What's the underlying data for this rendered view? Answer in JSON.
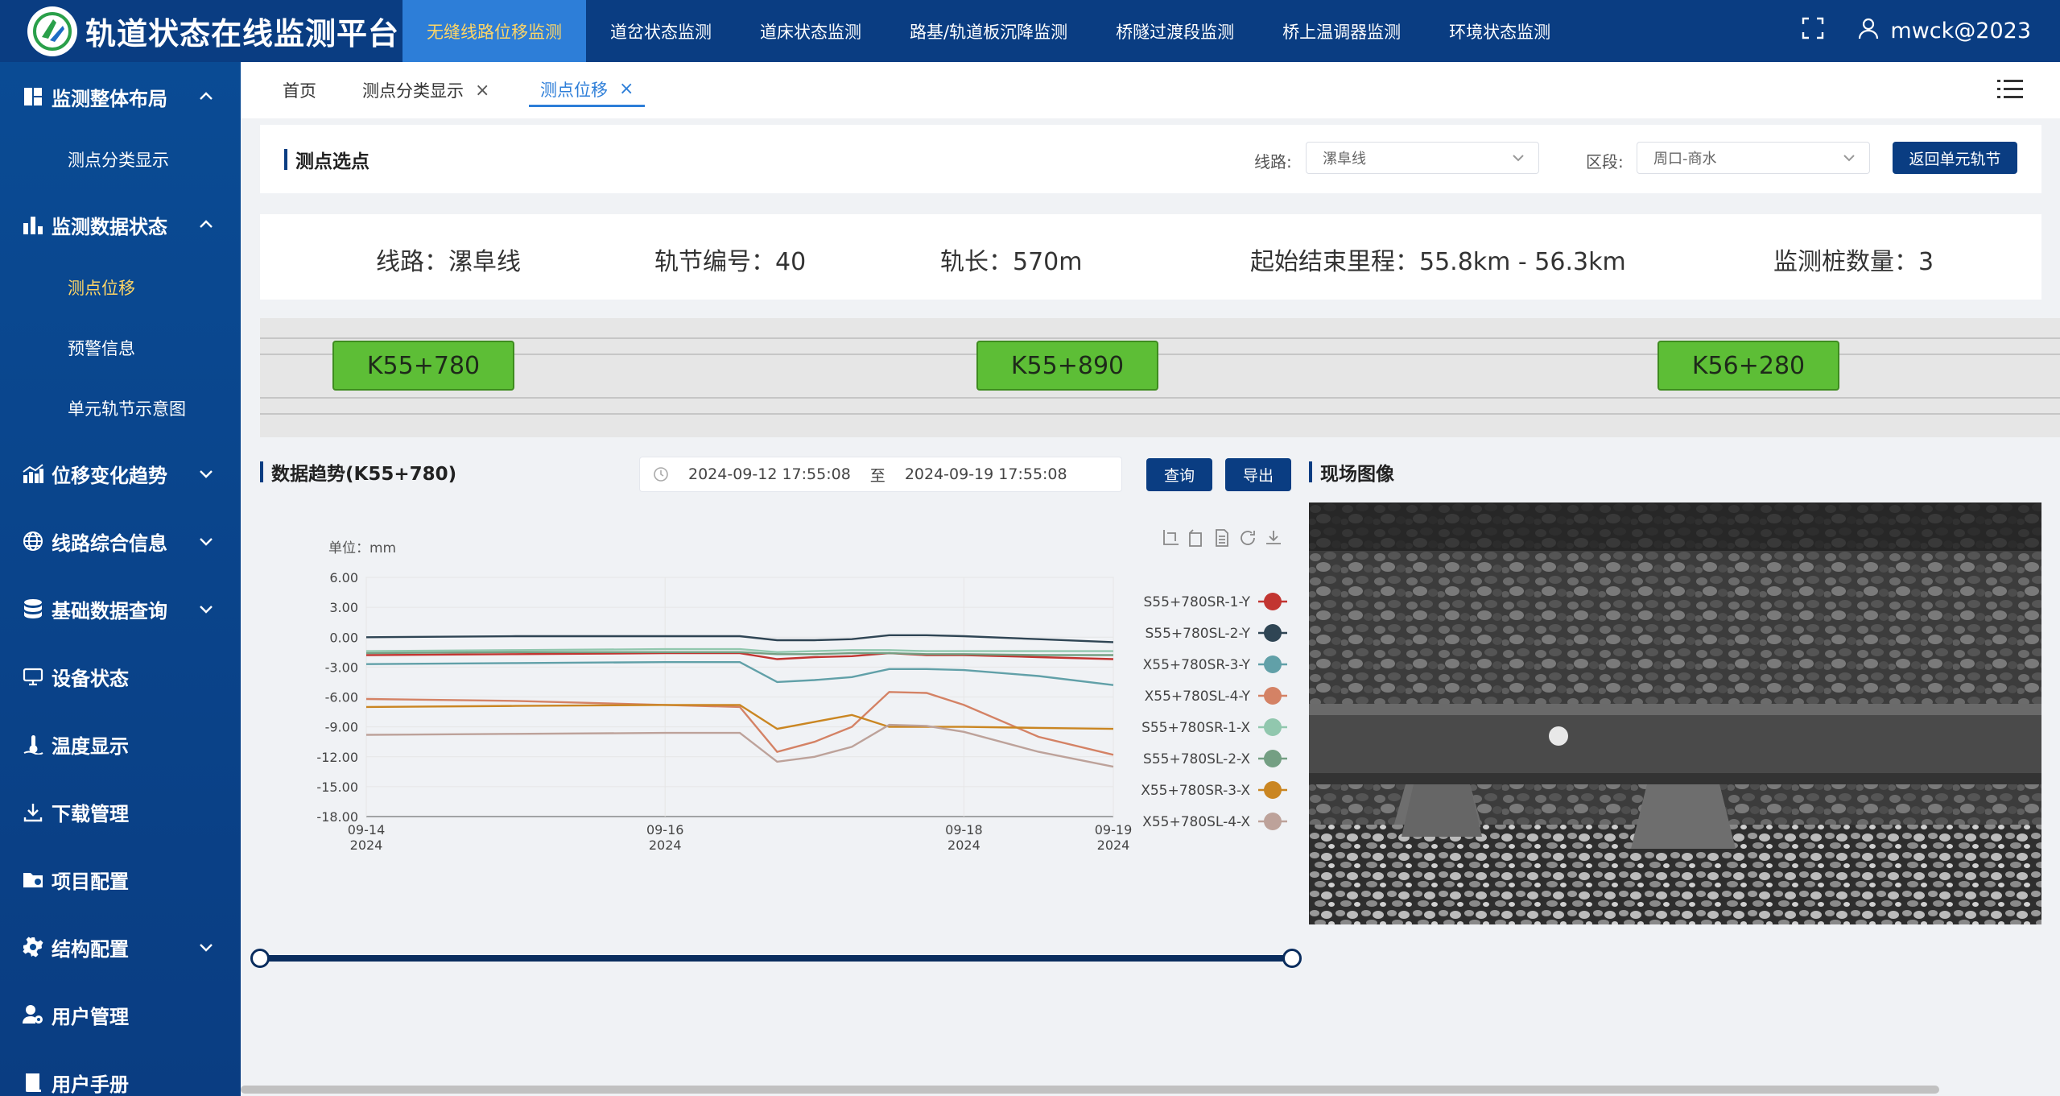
{
  "app": {
    "title": "轨道状态在线监测平台"
  },
  "topnav": [
    {
      "label": "无缝线路位移监测",
      "active": true
    },
    {
      "label": "道岔状态监测"
    },
    {
      "label": "道床状态监测"
    },
    {
      "label": "路基/轨道板沉降监测"
    },
    {
      "label": "桥隧过渡段监测"
    },
    {
      "label": "桥上温调器监测"
    },
    {
      "label": "环境状态监测"
    }
  ],
  "user": {
    "name": "mwck@2023"
  },
  "sidebar": {
    "groups": [
      {
        "label": "监测整体布局",
        "icon": "layout-icon",
        "expanded": true
      },
      {
        "label": "监测数据状态",
        "icon": "bar-chart-icon",
        "expanded": true
      },
      {
        "label": "位移变化趋势",
        "icon": "trend-icon"
      },
      {
        "label": "线路综合信息",
        "icon": "globe-icon"
      },
      {
        "label": "基础数据查询",
        "icon": "database-icon"
      },
      {
        "label": "设备状态",
        "icon": "monitor-icon"
      },
      {
        "label": "温度显示",
        "icon": "thermometer-icon"
      },
      {
        "label": "下载管理",
        "icon": "download-icon"
      },
      {
        "label": "项目配置",
        "icon": "folder-icon"
      },
      {
        "label": "结构配置",
        "icon": "gear-icon"
      },
      {
        "label": "用户管理",
        "icon": "user-gear-icon"
      },
      {
        "label": "用户手册",
        "icon": "book-icon"
      }
    ],
    "subs": [
      {
        "label": "测点分类显示"
      },
      {
        "label": "测点位移",
        "active": true
      },
      {
        "label": "预警信息"
      },
      {
        "label": "单元轨节示意图"
      }
    ]
  },
  "tabs": [
    {
      "label": "首页"
    },
    {
      "label": "测点分类显示",
      "close": "×"
    },
    {
      "label": "测点位移",
      "close": "×",
      "active": true
    }
  ],
  "selector": {
    "title": "测点选点",
    "line_label": "线路:",
    "line_value": "漯阜线",
    "section_label": "区段:",
    "section_value": "周口-商水",
    "return_button": "返回单元轨节"
  },
  "info": {
    "line": "线路：漯阜线",
    "rail_no": "轨节编号：40",
    "rail_len": "轨长：570m",
    "mileage": "起始结束里程：55.8km - 56.3km",
    "pile_count": "监测桩数量：3"
  },
  "stakes": [
    "K55+780",
    "K55+890",
    "K56+280"
  ],
  "trend": {
    "title": "数据趋势(K55+780)",
    "start": "2024-09-12 17:55:08",
    "to": "至",
    "end": "2024-09-19 17:55:08",
    "query_button": "查询",
    "export_button": "导出"
  },
  "site": {
    "title": "现场图像"
  },
  "colors": {
    "primary": "#0a3d82",
    "accent": "#2d7ed8",
    "highlight": "#ffd666",
    "stake_green": "#5dbe36"
  },
  "chart_data": {
    "type": "line",
    "unit_label": "单位：mm",
    "ylim": [
      -18,
      6
    ],
    "yticks": [
      "6.00",
      "3.00",
      "0.00",
      "-3.00",
      "-6.00",
      "-9.00",
      "-12.00",
      "-15.00",
      "-18.00"
    ],
    "xticks": [
      {
        "date": "09-14",
        "year": "2024"
      },
      {
        "date": "09-16",
        "year": "2024"
      },
      {
        "date": "09-18",
        "year": "2024"
      },
      {
        "date": "09-19",
        "year": "2024"
      }
    ],
    "x": [
      "2024-09-14",
      "2024-09-15",
      "2024-09-16",
      "2024-09-16 12:00",
      "2024-09-16 18:00",
      "2024-09-17",
      "2024-09-17 06:00",
      "2024-09-17 12:00",
      "2024-09-17 18:00",
      "2024-09-18",
      "2024-09-18 12:00",
      "2024-09-19"
    ],
    "series": [
      {
        "name": "S55+780SR-1-Y",
        "color": "#c23531",
        "values": [
          -1.8,
          -1.7,
          -1.6,
          -1.6,
          -2.2,
          -2.0,
          -1.9,
          -1.6,
          -1.8,
          -1.8,
          -2.0,
          -2.2
        ]
      },
      {
        "name": "S55+780SL-2-Y",
        "color": "#2f4554",
        "values": [
          0.0,
          0.1,
          0.1,
          0.1,
          -0.3,
          -0.3,
          -0.2,
          0.2,
          0.2,
          0.1,
          -0.2,
          -0.5
        ]
      },
      {
        "name": "X55+780SR-3-Y",
        "color": "#61a0a8",
        "values": [
          -2.7,
          -2.6,
          -2.5,
          -2.5,
          -4.5,
          -4.3,
          -4.0,
          -3.2,
          -3.2,
          -3.3,
          -3.9,
          -4.8
        ]
      },
      {
        "name": "X55+780SL-4-Y",
        "color": "#d48265",
        "values": [
          -6.2,
          -6.4,
          -6.8,
          -7.0,
          -11.5,
          -10.5,
          -9.0,
          -5.5,
          -5.6,
          -6.8,
          -10.0,
          -11.8
        ]
      },
      {
        "name": "S55+780SR-1-X",
        "color": "#91c7ae",
        "values": [
          -1.4,
          -1.3,
          -1.2,
          -1.2,
          -1.5,
          -1.4,
          -1.3,
          -1.3,
          -1.4,
          -1.4,
          -1.4,
          -1.4
        ]
      },
      {
        "name": "S55+780SL-2-X",
        "color": "#749f83",
        "values": [
          -1.6,
          -1.5,
          -1.5,
          -1.5,
          -1.7,
          -1.7,
          -1.6,
          -1.6,
          -1.7,
          -1.7,
          -1.8,
          -1.8
        ]
      },
      {
        "name": "X55+780SR-3-X",
        "color": "#ca8622",
        "values": [
          -7.0,
          -6.9,
          -6.8,
          -6.8,
          -9.2,
          -8.5,
          -7.8,
          -9.0,
          -9.0,
          -9.0,
          -9.1,
          -9.2
        ]
      },
      {
        "name": "X55+780SL-4-X",
        "color": "#bda29a",
        "values": [
          -9.8,
          -9.7,
          -9.6,
          -9.6,
          -12.5,
          -12.0,
          -11.0,
          -8.8,
          -8.9,
          -9.5,
          -11.5,
          -13.0
        ]
      }
    ]
  }
}
